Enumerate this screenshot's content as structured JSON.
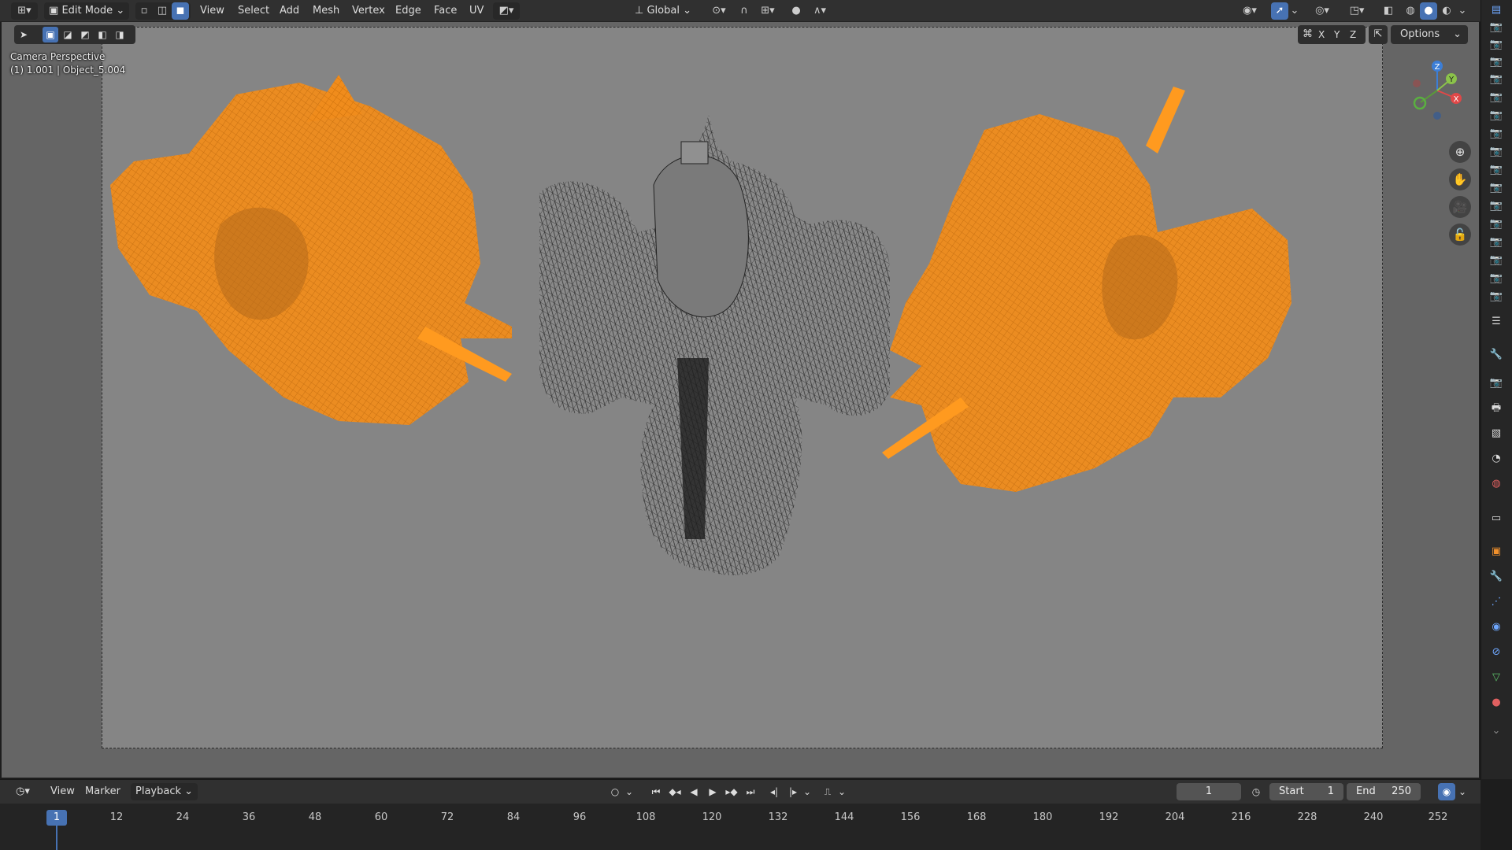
{
  "header": {
    "editor_type_icon": "editor-type-icon",
    "mode": "Edit Mode",
    "menus": [
      "View",
      "Select",
      "Add",
      "Mesh",
      "Vertex",
      "Edge",
      "Face",
      "UV"
    ],
    "transform_orientation": "Global",
    "accent": "#4772b3"
  },
  "viewport": {
    "view_name": "Camera Perspective",
    "object_info": "(1) 1.001 | Object_5.004",
    "axes": [
      "X",
      "Y",
      "Z"
    ],
    "options_label": "Options",
    "gizmo_labels": {
      "x": "X",
      "y": "Y",
      "z": "Z"
    },
    "selection_color": "#ff9a1f",
    "nav_icons": [
      "zoom-icon",
      "hand-pan-icon",
      "camera-icon",
      "lock-icon"
    ]
  },
  "timeline": {
    "menus": [
      "View",
      "Marker"
    ],
    "playback_label": "Playback",
    "current_frame": "1",
    "start_label": "Start",
    "start_value": "1",
    "end_label": "End",
    "end_value": "250",
    "ruler_ticks": [
      "12",
      "24",
      "36",
      "48",
      "60",
      "72",
      "84",
      "96",
      "108",
      "120",
      "132",
      "144",
      "156",
      "168",
      "180",
      "192",
      "204",
      "216",
      "228",
      "240",
      "252"
    ],
    "playhead_label": "1"
  }
}
